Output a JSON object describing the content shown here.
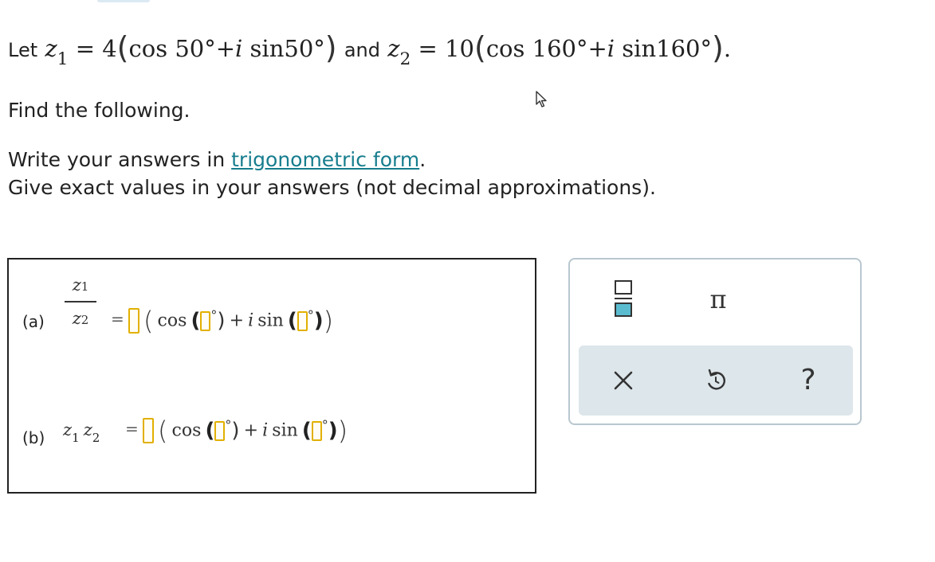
{
  "statement": {
    "let": "Let",
    "z": "z",
    "sub1": "1",
    "sub2": "2",
    "eq": "=",
    "z1_mod": "4",
    "z1_angle": "50°",
    "and": "and",
    "z2_mod": "10",
    "z2_angle": "160°",
    "cos": "cos",
    "sin": "sin",
    "plus": "+",
    "i": "i",
    "period": "."
  },
  "prompt": {
    "find": "Find the following.",
    "write_prefix": "Write your answers in",
    "write_link": "trigonometric form",
    "write_suffix": ".",
    "exact": "Give exact values in your answers (not decimal approximations)."
  },
  "parts": [
    {
      "label": "(a)"
    },
    {
      "label": "(b)"
    }
  ],
  "math": {
    "z": "z",
    "one": "1",
    "two": "2",
    "equals": "=",
    "cos": "cos",
    "sin": "sin",
    "plus": "+",
    "i": "i",
    "deg": "°",
    "lparen": "(",
    "rparen": ")"
  },
  "tools": {
    "pi": "π",
    "help": "?"
  },
  "colors": {
    "link": "#177d8e",
    "blank_border": "#e2b000",
    "fraction_fill": "#5bbcd0",
    "strip_bg": "#dde6ea",
    "panel_border": "#b9c7cf"
  },
  "icons": [
    "cursor-icon",
    "fraction-icon",
    "clear-icon",
    "undo-icon",
    "help-icon"
  ]
}
